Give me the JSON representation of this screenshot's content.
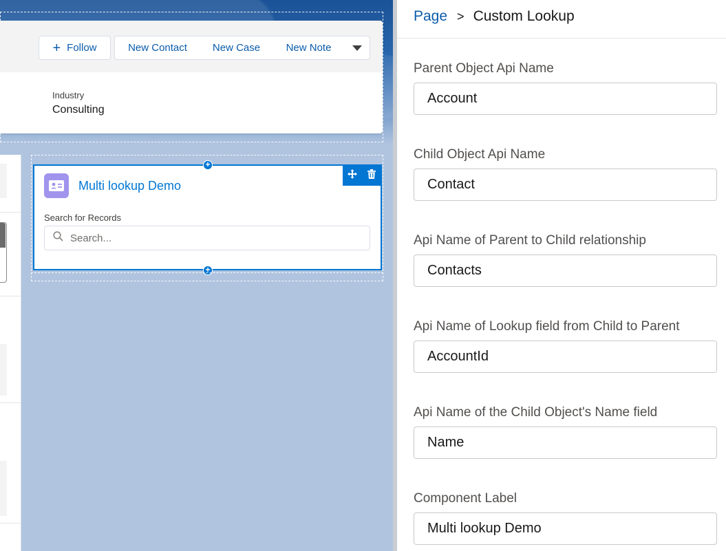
{
  "header": {
    "follow_label": "Follow",
    "actions": [
      "New Contact",
      "New Case",
      "New Note"
    ],
    "field_label": "Industry",
    "field_value": "Consulting"
  },
  "component": {
    "title": "Multi lookup Demo",
    "search_label": "Search for Records",
    "search_placeholder": "Search..."
  },
  "panel": {
    "breadcrumb_link": "Page",
    "breadcrumb_sep": ">",
    "breadcrumb_current": "Custom Lookup",
    "properties": [
      {
        "label": "Parent Object Api Name",
        "value": "Account"
      },
      {
        "label": "Child Object Api Name",
        "value": "Contact"
      },
      {
        "label": "Api Name of Parent to Child relationship",
        "value": "Contacts"
      },
      {
        "label": "Api Name of Lookup field from Child to Parent",
        "value": "AccountId"
      },
      {
        "label": "Api Name of the Child Object's Name field",
        "value": "Name"
      },
      {
        "label": "Component Label",
        "value": "Multi lookup Demo"
      }
    ]
  },
  "colors": {
    "brand": "#0176d3",
    "canvas": "#b0c4df",
    "icon_bg": "#a094ed"
  }
}
